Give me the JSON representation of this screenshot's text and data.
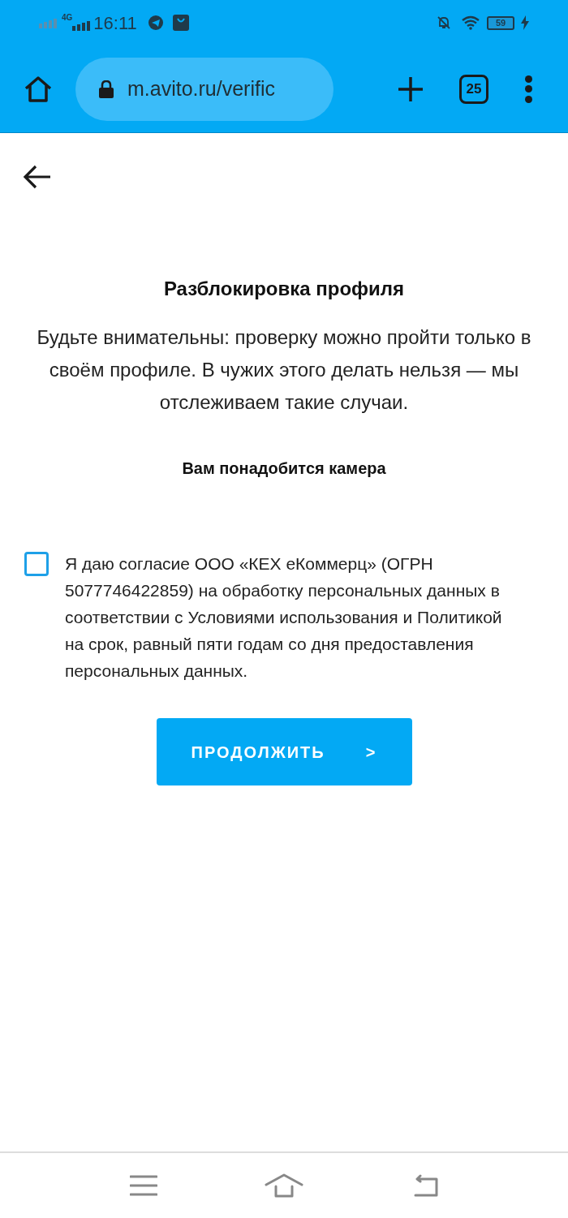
{
  "status_bar": {
    "network": "4G",
    "time": "16:11",
    "battery": "59"
  },
  "browser": {
    "url": "m.avito.ru/verific",
    "tab_count": "25"
  },
  "page": {
    "title": "Разблокировка профиля",
    "description": "Будьте внимательны: проверку можно пройти только в своём профиле. В чужих этого делать нельзя — мы отслеживаем такие случаи.",
    "subtitle": "Вам понадобится камера",
    "consent": {
      "checked": false,
      "text": "Я даю согласие ООО «КЕХ еКоммерц» (ОГРН 5077746422859) на обработку персональных данных в соответствии с Условиями использования и Политикой на срок, равный пяти годам со дня предоставления персональных данных."
    },
    "button": {
      "label": "ПРОДОЛЖИТЬ",
      "arrow": ">"
    }
  }
}
